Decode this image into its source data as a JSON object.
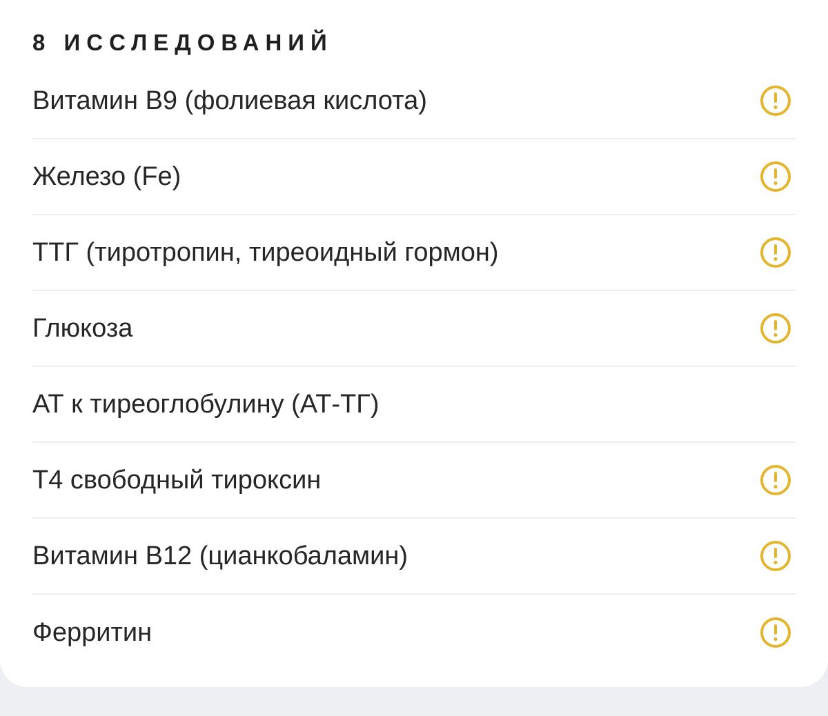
{
  "header": {
    "title": "8 ИССЛЕДОВАНИЙ"
  },
  "colors": {
    "warning": "#e4b62f",
    "text": "#262626",
    "divider": "#eceef2",
    "background": "#eeeff3",
    "card": "#ffffff"
  },
  "tests": [
    {
      "label": "Витамин B9 (фолиевая кислота)",
      "icon": "warning-icon"
    },
    {
      "label": "Железо (Fe)",
      "icon": "warning-icon"
    },
    {
      "label": "ТТГ (тиротропин, тиреоидный гормон)",
      "icon": "warning-icon"
    },
    {
      "label": "Глюкоза",
      "icon": "warning-icon"
    },
    {
      "label": "АТ к тиреоглобулину (АТ-ТГ)",
      "icon": null
    },
    {
      "label": "Т4 свободный тироксин",
      "icon": "warning-icon"
    },
    {
      "label": "Витамин B12 (цианкобаламин)",
      "icon": "warning-icon"
    },
    {
      "label": "Ферритин",
      "icon": "warning-icon"
    }
  ]
}
